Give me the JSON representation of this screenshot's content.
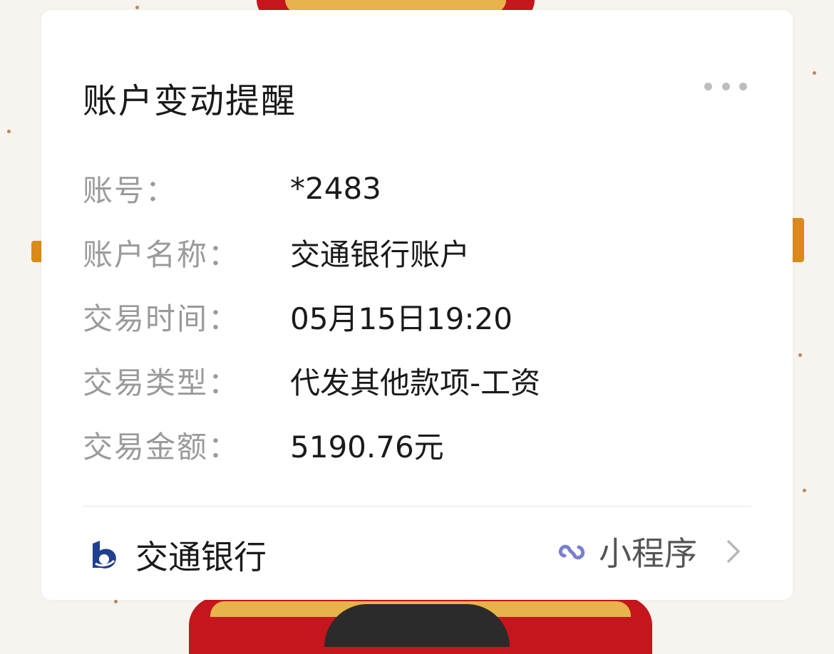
{
  "card": {
    "title": "账户变动提醒",
    "more_icon": "ellipsis-icon"
  },
  "fields": [
    {
      "label": "账号：",
      "value": "*2483"
    },
    {
      "label": "账户名称：",
      "value": "交通银行账户"
    },
    {
      "label": "交易时间：",
      "value": "05月15日19:20"
    },
    {
      "label": "交易类型：",
      "value": "代发其他款项-工资"
    },
    {
      "label": "交易金额：",
      "value": "5190.76元"
    }
  ],
  "footer": {
    "bank_name": "交通银行",
    "bank_logo_icon": "bank-logo-icon",
    "mini_program_label": "小程序",
    "mini_program_icon": "mini-program-icon",
    "chevron_icon": "chevron-right-icon"
  },
  "colors": {
    "label": "#9a9a9a",
    "value": "#1a1a1a",
    "bank_logo": "#1f3f8f",
    "mini_program_icon": "#7b7fd0",
    "festive_red": "#c4161c",
    "festive_gold": "#e8b34a"
  }
}
